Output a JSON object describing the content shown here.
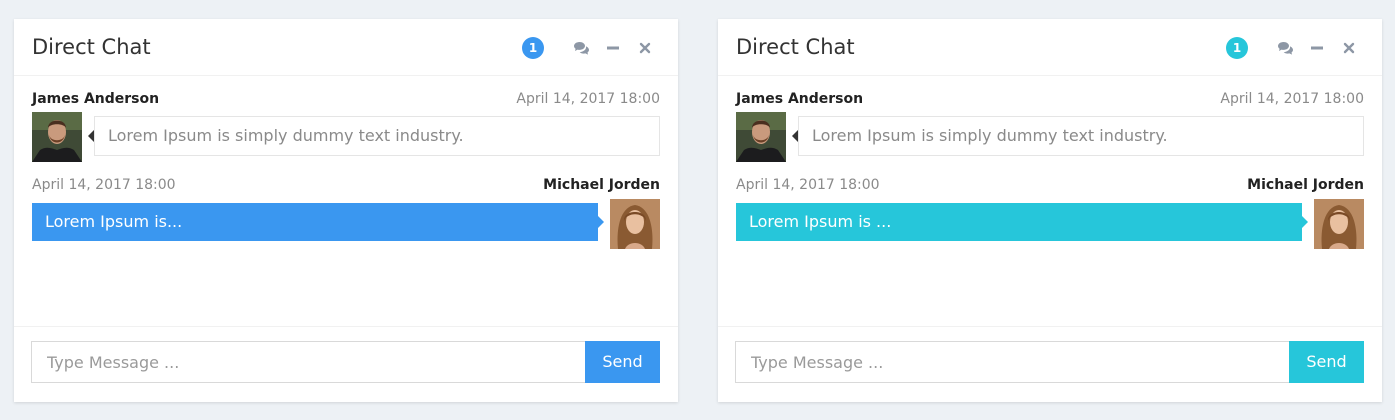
{
  "panels": [
    {
      "title": "Direct Chat",
      "badge": "1",
      "accent": "#3a97f0",
      "messages": [
        {
          "name": "James Anderson",
          "time": "April 14, 2017 18:00",
          "text": "Lorem Ipsum is simply dummy text industry.",
          "side": "left"
        },
        {
          "name": "Michael Jorden",
          "time": "April 14, 2017 18:00",
          "text": "Lorem Ipsum is...",
          "side": "right"
        }
      ],
      "input_placeholder": "Type Message ...",
      "send_label": "Send"
    },
    {
      "title": "Direct Chat",
      "badge": "1",
      "accent": "#26c6da",
      "messages": [
        {
          "name": "James Anderson",
          "time": "April 14, 2017 18:00",
          "text": "Lorem Ipsum is simply dummy text industry.",
          "side": "left"
        },
        {
          "name": "Michael Jorden",
          "time": "April 14, 2017 18:00",
          "text": "Lorem Ipsum is ...",
          "side": "right"
        }
      ],
      "input_placeholder": "Type Message ...",
      "send_label": "Send"
    }
  ],
  "icons": {
    "chat": "comments-icon",
    "minimize": "minus-icon",
    "close": "times-icon"
  }
}
